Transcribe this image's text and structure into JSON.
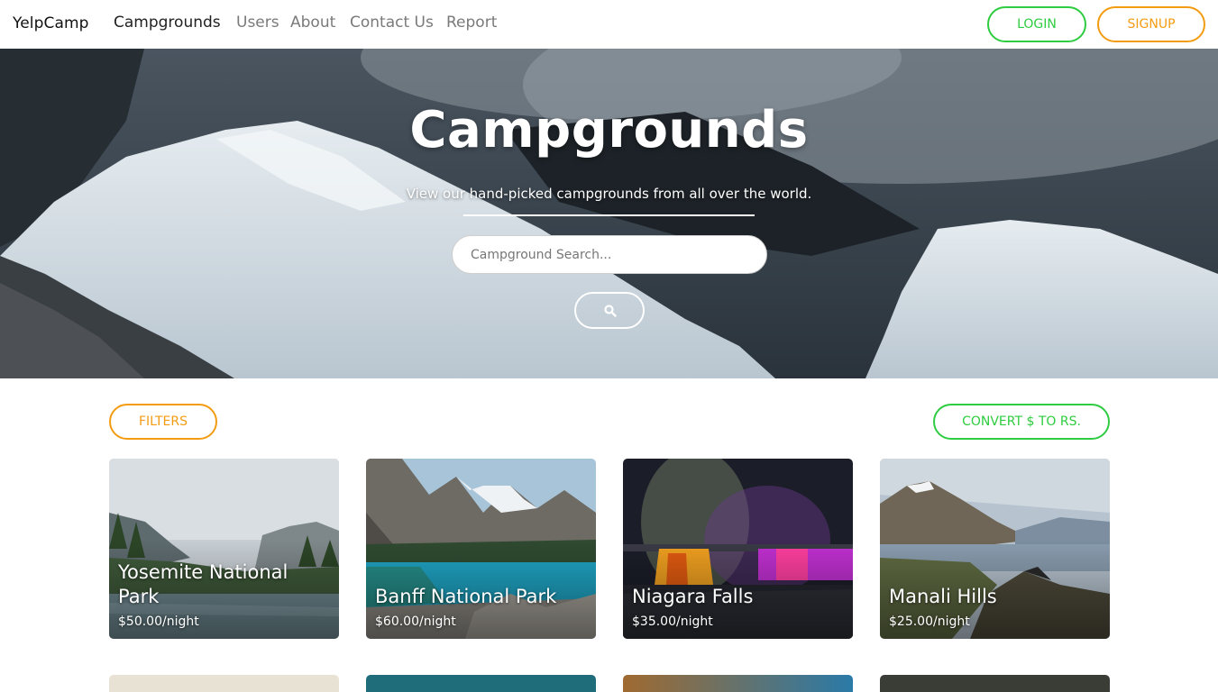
{
  "navbar": {
    "brand": "YelpCamp",
    "links": [
      "Campgrounds",
      "Users",
      "About",
      "Contact Us",
      "Report"
    ],
    "active": "Campgrounds",
    "login_label": "LOGIN",
    "signup_label": "SIGNUP"
  },
  "hero": {
    "title": "Campgrounds",
    "subtitle": "View our hand-picked campgrounds from all over the world.",
    "search_placeholder": "Campground Search...",
    "search_icon": "search-icon"
  },
  "controls": {
    "filters_label": "FILTERS",
    "convert_label": "CONVERT $ TO RS."
  },
  "campgrounds": [
    {
      "name": "Yosemite National Park",
      "price": "$50.00/night"
    },
    {
      "name": "Banff National Park",
      "price": "$60.00/night"
    },
    {
      "name": "Niagara Falls",
      "price": "$35.00/night"
    },
    {
      "name": "Manali Hills",
      "price": "$25.00/night"
    }
  ],
  "colors": {
    "accent_green": "#2ecc40",
    "accent_orange": "#f39c12",
    "nav_text_muted": "#7a7a7a"
  }
}
